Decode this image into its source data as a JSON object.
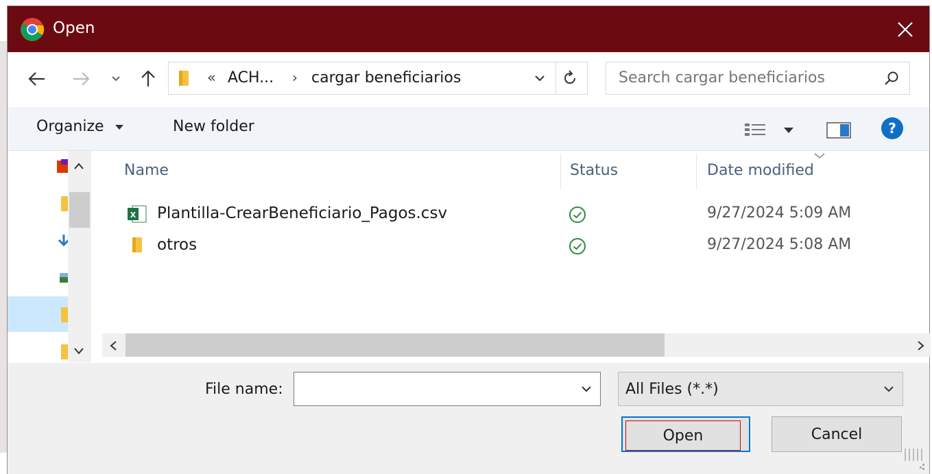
{
  "window": {
    "title": "Open",
    "titlebar_color": "#6b0a10"
  },
  "address_bar": {
    "overflow_chevron": "«",
    "segments": [
      "ACH...",
      "cargar beneficiarios"
    ],
    "separator": "›"
  },
  "search": {
    "placeholder": "Search cargar beneficiarios"
  },
  "toolbar": {
    "organize_label": "Organize",
    "new_folder_label": "New folder"
  },
  "columns": {
    "name": "Name",
    "status": "Status",
    "date_modified": "Date modified"
  },
  "files": [
    {
      "name": "Plantilla-CrearBeneficiario_Pagos.csv",
      "icon": "excel-csv-icon",
      "status": "synced",
      "date": "9/27/2024 5:09 AM"
    },
    {
      "name": "otros",
      "icon": "folder-icon",
      "status": "synced",
      "date": "9/27/2024 5:08 AM"
    }
  ],
  "footer": {
    "file_name_label": "File name:",
    "file_name_value": "",
    "file_type_value": "All Files (*.*)",
    "open_label": "Open",
    "cancel_label": "Cancel"
  },
  "colors": {
    "accent": "#0078d7",
    "status_ok": "#2e8b3e",
    "selection": "#cce8ff",
    "focus_outline": "#d40000"
  }
}
